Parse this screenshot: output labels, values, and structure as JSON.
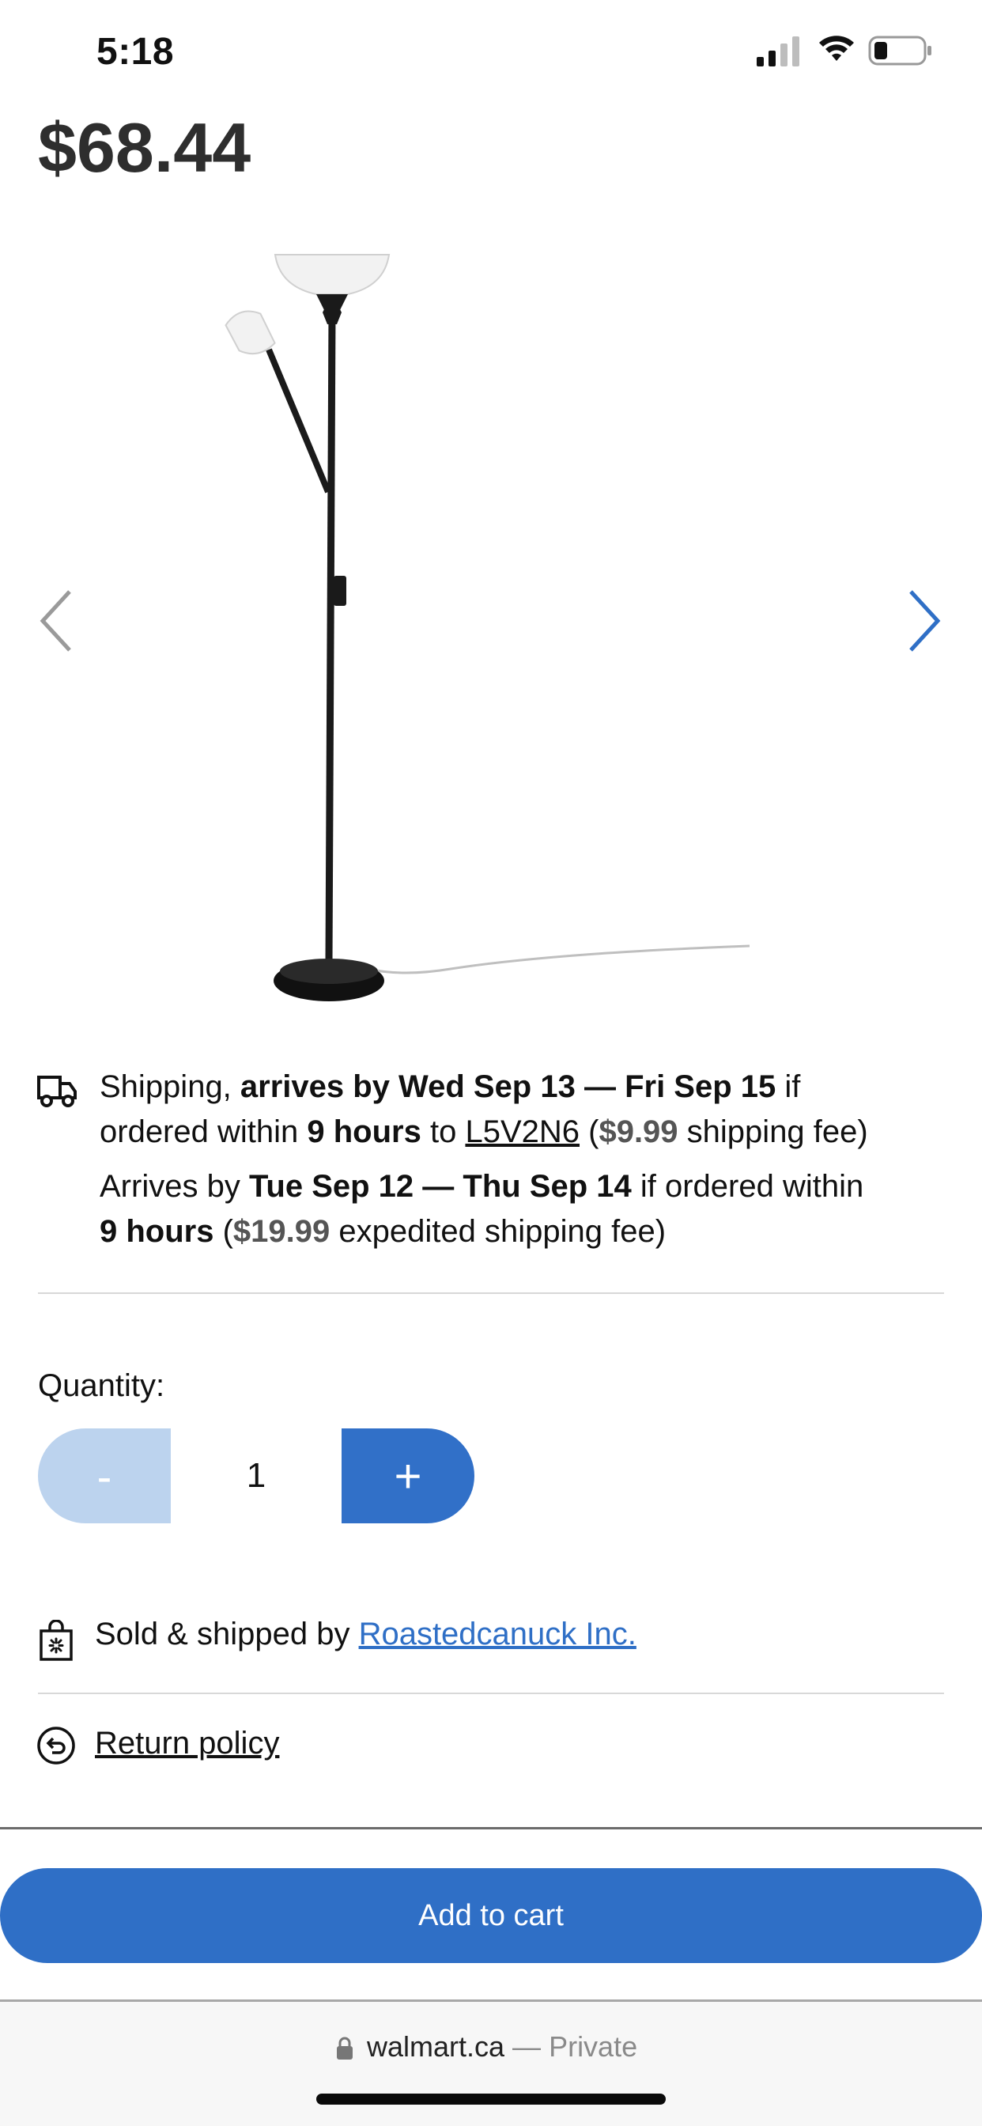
{
  "status_bar": {
    "time": "5:18"
  },
  "product": {
    "price": "$68.44",
    "image_name": "floor lamp with reading light"
  },
  "shipping": {
    "line1_a": "Shipping, ",
    "line1_b": "arrives by Wed Sep 13 — Fri Sep 15",
    "line1_c": " if",
    "line2_a": "ordered within ",
    "line2_b": "9 hours",
    "line2_c": " to ",
    "line2_postal": "L5V2N6",
    "line2_d": " (",
    "line2_fee": "$9.99",
    "line2_e": " shipping fee)",
    "line3_a": "Arrives by ",
    "line3_b": "Tue Sep 12 — Thu Sep 14",
    "line3_c": " if ordered within",
    "line4_b": "9 hours",
    "line4_a": " (",
    "line4_fee": "$19.99",
    "line4_c": " expedited shipping fee)"
  },
  "quantity": {
    "label": "Quantity:",
    "minus": "-",
    "value": "1",
    "plus": "+"
  },
  "seller": {
    "prefix": "Sold & shipped by ",
    "name": "Roastedcanuck Inc."
  },
  "return_policy": {
    "label": "Return policy"
  },
  "cart": {
    "button_label": "Add to cart",
    "accent_color": "#2f6fc6"
  },
  "browser": {
    "domain": "walmart.ca",
    "separator": " — ",
    "mode": "Private"
  },
  "icons": [
    "signal-icon",
    "wifi-icon",
    "battery-icon",
    "chevron-left-icon",
    "chevron-right-icon",
    "truck-icon",
    "shopping-bag-icon",
    "return-icon",
    "lock-icon"
  ]
}
